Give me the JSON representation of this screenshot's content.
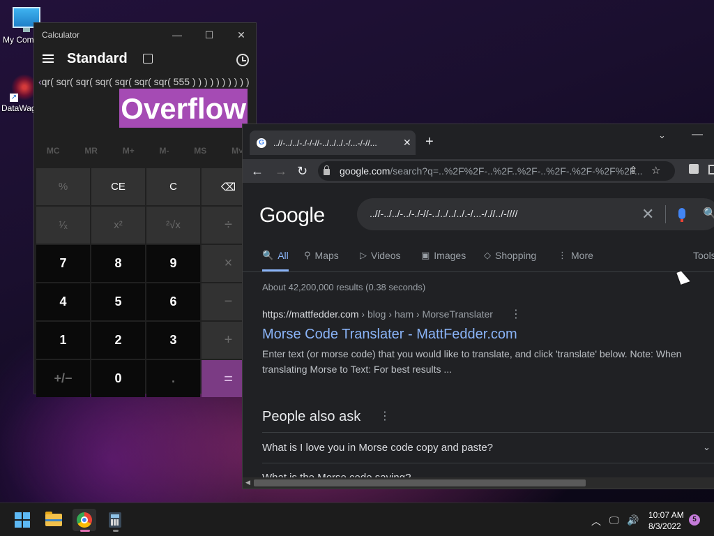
{
  "desktop": {
    "icons": [
      {
        "label": "My Com",
        "icon": "computer-icon"
      },
      {
        "label": "DataWag",
        "icon": "datawagon-app-icon"
      }
    ]
  },
  "calculator": {
    "window_title": "Calculator",
    "mode": "Standard",
    "expression": "qr( sqr( sqr( sqr( sqr( sqr( sqr( 555 ) ) ) ) ) ) ) ) ) ) ) )",
    "display": "Overflow",
    "memory_buttons": [
      "MC",
      "MR",
      "M+",
      "M-",
      "MS",
      "M˅"
    ],
    "keys": [
      {
        "label": "%",
        "kind": "dim"
      },
      {
        "label": "CE",
        "kind": "fn"
      },
      {
        "label": "C",
        "kind": "fn"
      },
      {
        "label": "⌫",
        "kind": "fn"
      },
      {
        "label": "¹⁄ₓ",
        "kind": "dim"
      },
      {
        "label": "x²",
        "kind": "dim"
      },
      {
        "label": "²√x",
        "kind": "dim"
      },
      {
        "label": "÷",
        "kind": "op"
      },
      {
        "label": "7",
        "kind": "num"
      },
      {
        "label": "8",
        "kind": "num"
      },
      {
        "label": "9",
        "kind": "num"
      },
      {
        "label": "×",
        "kind": "op"
      },
      {
        "label": "4",
        "kind": "num"
      },
      {
        "label": "5",
        "kind": "num"
      },
      {
        "label": "6",
        "kind": "num"
      },
      {
        "label": "−",
        "kind": "op"
      },
      {
        "label": "1",
        "kind": "num"
      },
      {
        "label": "2",
        "kind": "num"
      },
      {
        "label": "3",
        "kind": "num"
      },
      {
        "label": "+",
        "kind": "op"
      },
      {
        "label": "+/−",
        "kind": "numdim"
      },
      {
        "label": "0",
        "kind": "num"
      },
      {
        "label": ".",
        "kind": "numdim"
      },
      {
        "label": "=",
        "kind": "eq"
      }
    ]
  },
  "browser": {
    "tab_title": "..//-../../-./-/-//-../../../.-/...-/-//...",
    "url_host": "google.com",
    "url_rest": "/search?q=..%2F%2F-..%2F..%2F-..%2F-.%2F-%2F%2F...",
    "search_query": "..//-../../-../-./-//-../../../../.-/...-/.//../-////",
    "logo": "Google",
    "tabs": [
      {
        "label": "All",
        "icon": "search-icon",
        "active": true
      },
      {
        "label": "Maps",
        "icon": "map-pin-icon"
      },
      {
        "label": "Videos",
        "icon": "play-icon"
      },
      {
        "label": "Images",
        "icon": "image-icon"
      },
      {
        "label": "Shopping",
        "icon": "tag-icon"
      },
      {
        "label": "More",
        "icon": "more-vert-icon"
      },
      {
        "label": "Tools"
      }
    ],
    "result_stats": "About 42,200,000 results (0.38 seconds)",
    "result": {
      "site": "https://mattfedder.com",
      "breadcrumb": " › blog › ham › MorseTranslater",
      "title": "Morse Code Translater - MattFedder.com",
      "snippet": "Enter text (or morse code) that you would like to translate, and click 'translate' below. Note: When translating Morse to Text: For best results ..."
    },
    "people_also_ask": {
      "heading": "People also ask",
      "questions": [
        "What is I love you in Morse code copy and paste?",
        "What is the Morse code saying?"
      ]
    }
  },
  "taskbar": {
    "time": "10:07 AM",
    "date": "8/3/2022",
    "notifications": "5"
  }
}
